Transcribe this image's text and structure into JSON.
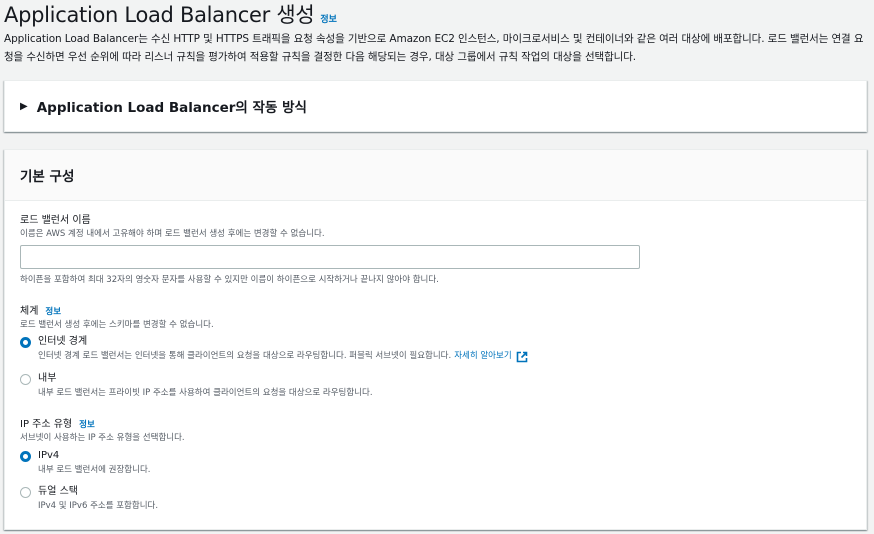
{
  "header": {
    "title": "Application Load Balancer 생성",
    "info": "정보",
    "description": "Application Load Balancer는 수신 HTTP 및 HTTPS 트래픽을 요청 속성을 기반으로 Amazon EC2 인스턴스, 마이크로서비스 및 컨테이너와 같은 여러 대상에 배포합니다. 로드 밸런서는 연결 요청을 수신하면 우선 순위에 따라 리스너 규칙을 평가하여 적용할 규칙을 결정한 다음 해당되는 경우, 대상 그룹에서 규칙 작업의 대상을 선택합니다."
  },
  "how_it_works": {
    "label": "Application Load Balancer의 작동 방식",
    "expanded": false
  },
  "basic_config": {
    "title": "기본 구성",
    "name_field": {
      "label": "로드 밸런서 이름",
      "description": "이름은 AWS 계정 내에서 고유해야 하며 로드 밸런서 생성 후에는 변경할 수 없습니다.",
      "value": "",
      "placeholder": "",
      "hint": "하이픈을 포함하여 최대 32자의 영숫자 문자를 사용할 수 있지만 이름이 하이픈으로 시작하거나 끝나지 않아야 합니다."
    },
    "scheme": {
      "label": "체계",
      "info": "정보",
      "description": "로드 밸런서 생성 후에는 스키마를 변경할 수 없습니다.",
      "options": [
        {
          "label": "인터넷 경계",
          "description": "인터넷 경계 로드 밸런서는 인터넷을 통해 클라이언트의 요청을 대상으로 라우팅합니다. 퍼블릭 서브넷이 필요합니다.",
          "link": "자세히 알아보기",
          "checked": true
        },
        {
          "label": "내부",
          "description": "내부 로드 밸런서는 프라이빗 IP 주소를 사용하여 클라이언트의 요청을 대상으로 라우팅합니다.",
          "checked": false
        }
      ]
    },
    "ip_type": {
      "label": "IP 주소 유형",
      "info": "정보",
      "description": "서브넷이 사용하는 IP 주소 유형을 선택합니다.",
      "options": [
        {
          "label": "IPv4",
          "description": "내부 로드 밸런서에 권장합니다.",
          "checked": true
        },
        {
          "label": "듀얼 스택",
          "description": "IPv4 및 IPv6 주소를 포함합니다.",
          "checked": false
        }
      ]
    }
  },
  "colors": {
    "accent": "#0073bb",
    "text": "#16191f",
    "muted": "#545b64",
    "background": "#f2f3f3"
  },
  "icons": {
    "caret": "caret-right-icon",
    "external": "external-link-icon"
  }
}
